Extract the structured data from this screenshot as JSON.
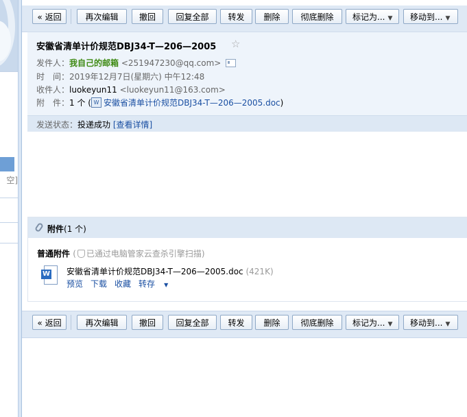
{
  "sidebar": {
    "empty_label": "空]"
  },
  "toolbar": {
    "back": "« 返回",
    "reedit": "再次编辑",
    "recall": "撤回",
    "reply_all": "回复全部",
    "forward": "转发",
    "delete": "删除",
    "delete_permanent": "彻底删除",
    "mark_as": "标记为...",
    "move_to": "移动到..."
  },
  "mail": {
    "subject": "安徽省清单计价规范DBJ34-T—206—2005",
    "from_label": "发件人：",
    "from_name": "我自己的邮箱",
    "from_addr": "<251947230@qq.com>",
    "time_label": "时　间：",
    "time_value": "2019年12月7日(星期六) 中午12:48",
    "to_label": "收件人：",
    "to_name": "luokeyun11",
    "to_addr": "<luokeyun11@163.com>",
    "att_label": "附　件：",
    "att_count": "1 个",
    "att_open": "(",
    "att_file": "安徽省清单计价规范DBJ34-T—206—2005.doc",
    "att_close": ")",
    "status_label": "发送状态：",
    "status_value": "投递成功",
    "status_link": "[查看详情]"
  },
  "attachments": {
    "title": "附件",
    "count": "(1 个)",
    "type_label": "普通附件",
    "scan_text": "已通过电脑管家云查杀引擎扫描",
    "file_name": "安徽省清单计价规范DBJ34-T—206—2005.doc",
    "file_size": "(421K)",
    "actions": {
      "preview": "预览",
      "download": "下载",
      "favorite": "收藏",
      "save_to": "转存"
    }
  },
  "icons": [
    "star-icon",
    "contact-card-icon",
    "doc-file-icon",
    "paperclip-icon",
    "shield-icon",
    "word-doc-icon",
    "dropdown-arrow-icon"
  ],
  "colors": {
    "sender_green": "#3e8a13",
    "link_blue": "#1a4fa2",
    "toolbar_bg": "#dfe9f5"
  }
}
